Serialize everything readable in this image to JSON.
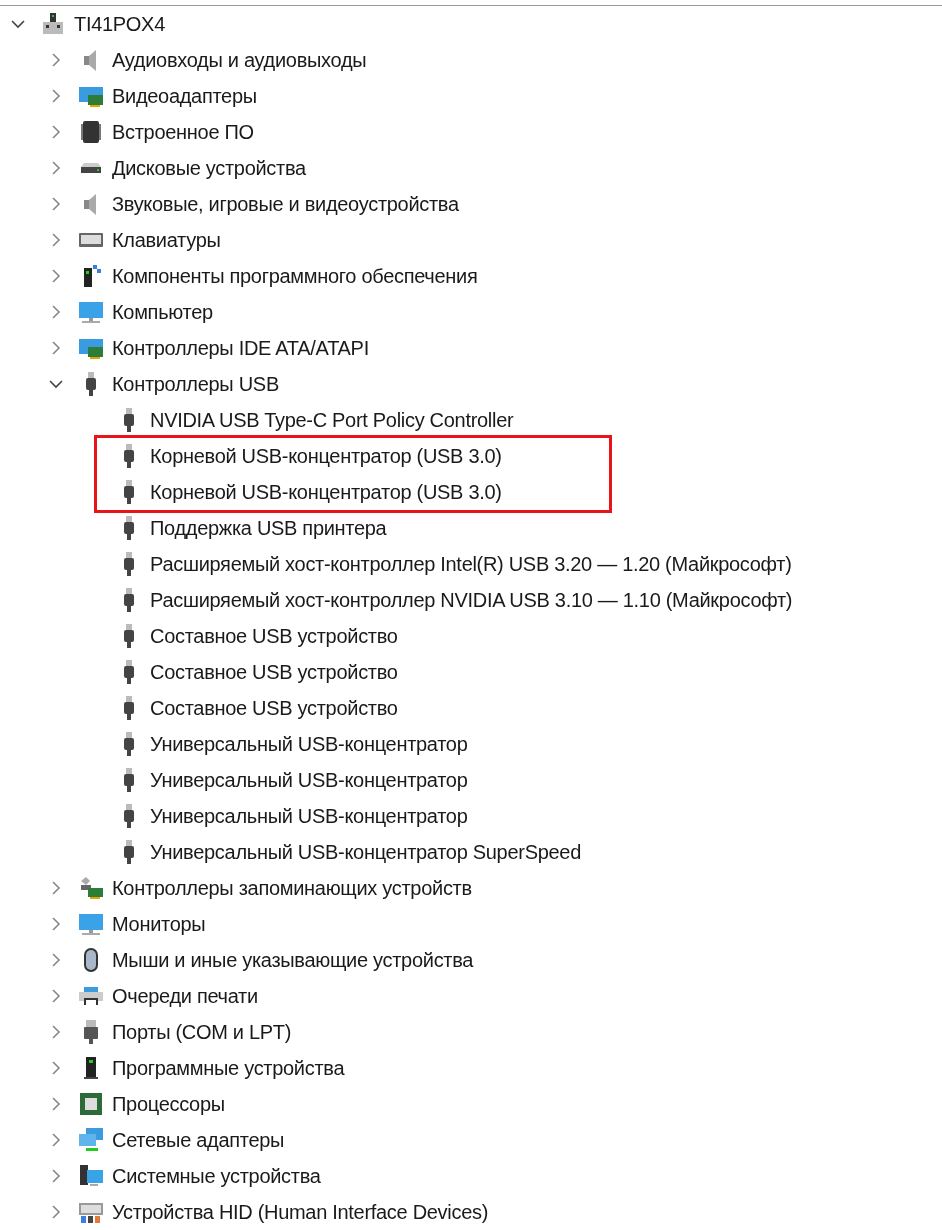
{
  "tree": [
    {
      "label": "TI41POX4",
      "kind": "computer-root",
      "expanded": true,
      "children": [
        {
          "label": "Аудиовходы и аудиовыходы",
          "kind": "speaker",
          "expanded": false
        },
        {
          "label": "Видеоадаптеры",
          "kind": "display-adapter",
          "expanded": false
        },
        {
          "label": "Встроенное ПО",
          "kind": "chip",
          "expanded": false
        },
        {
          "label": "Дисковые устройства",
          "kind": "disk",
          "expanded": false
        },
        {
          "label": "Звуковые, игровые и видеоустройства",
          "kind": "speaker",
          "expanded": false
        },
        {
          "label": "Клавиатуры",
          "kind": "keyboard",
          "expanded": false
        },
        {
          "label": "Компоненты программного обеспечения",
          "kind": "software",
          "expanded": false
        },
        {
          "label": "Компьютер",
          "kind": "monitor",
          "expanded": false
        },
        {
          "label": "Контроллеры IDE ATA/ATAPI",
          "kind": "display-adapter",
          "expanded": false
        },
        {
          "label": "Контроллеры USB",
          "kind": "usb",
          "expanded": true,
          "children": [
            {
              "label": "NVIDIA USB Type-C Port Policy Controller",
              "kind": "usb",
              "highlighted": false
            },
            {
              "label": "Корневой USB-концентратор (USB 3.0)",
              "kind": "usb",
              "highlighted": true
            },
            {
              "label": "Корневой USB-концентратор (USB 3.0)",
              "kind": "usb",
              "highlighted": true
            },
            {
              "label": "Поддержка USB принтера",
              "kind": "usb",
              "highlighted": false
            },
            {
              "label": "Расширяемый хост-контроллер Intel(R) USB 3.20 — 1.20 (Майкрософт)",
              "kind": "usb",
              "highlighted": false
            },
            {
              "label": "Расширяемый хост-контроллер NVIDIA USB 3.10 — 1.10 (Майкрософт)",
              "kind": "usb",
              "highlighted": false
            },
            {
              "label": "Составное USB устройство",
              "kind": "usb",
              "highlighted": false
            },
            {
              "label": "Составное USB устройство",
              "kind": "usb",
              "highlighted": false
            },
            {
              "label": "Составное USB устройство",
              "kind": "usb",
              "highlighted": false
            },
            {
              "label": "Универсальный USB-концентратор",
              "kind": "usb",
              "highlighted": false
            },
            {
              "label": "Универсальный USB-концентратор",
              "kind": "usb",
              "highlighted": false
            },
            {
              "label": "Универсальный USB-концентратор",
              "kind": "usb",
              "highlighted": false
            },
            {
              "label": "Универсальный USB-концентратор SuperSpeed",
              "kind": "usb",
              "highlighted": false
            }
          ]
        },
        {
          "label": "Контроллеры запоминающих устройств",
          "kind": "storage",
          "expanded": false
        },
        {
          "label": "Мониторы",
          "kind": "monitor",
          "expanded": false
        },
        {
          "label": "Мыши и иные указывающие устройства",
          "kind": "mouse",
          "expanded": false
        },
        {
          "label": "Очереди печати",
          "kind": "printer",
          "expanded": false
        },
        {
          "label": "Порты (COM и LPT)",
          "kind": "port",
          "expanded": false
        },
        {
          "label": "Программные устройства",
          "kind": "software-device",
          "expanded": false
        },
        {
          "label": "Процессоры",
          "kind": "processor",
          "expanded": false
        },
        {
          "label": "Сетевые адаптеры",
          "kind": "network",
          "expanded": false
        },
        {
          "label": "Системные устройства",
          "kind": "system",
          "expanded": false
        },
        {
          "label": "Устройства HID (Human Interface Devices)",
          "kind": "hid",
          "expanded": false
        }
      ]
    }
  ]
}
